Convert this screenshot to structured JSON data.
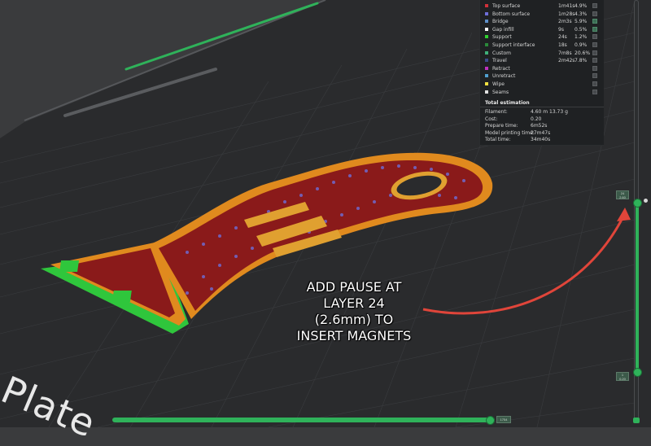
{
  "legend": {
    "features": [
      {
        "label": "Top surface",
        "time": "1m41s",
        "percent": "4.9%",
        "color": "#d0303a",
        "checked": false
      },
      {
        "label": "Bottom surface",
        "time": "1m28s",
        "percent": "4.3%",
        "color": "#6e6ed8",
        "checked": false
      },
      {
        "label": "Bridge",
        "time": "2m3s",
        "percent": "5.9%",
        "color": "#5d8fc9",
        "checked": true
      },
      {
        "label": "Gap infill",
        "time": "9s",
        "percent": "0.5%",
        "color": "#ffffff",
        "checked": true
      },
      {
        "label": "Support",
        "time": "24s",
        "percent": "1.2%",
        "color": "#2fd12f",
        "checked": false
      },
      {
        "label": "Support interface",
        "time": "18s",
        "percent": "0.9%",
        "color": "#2a8a3a",
        "checked": false
      },
      {
        "label": "Custom",
        "time": "7m8s",
        "percent": "20.6%",
        "color": "#3fb07a",
        "checked": false
      },
      {
        "label": "Travel",
        "time": "2m42s",
        "percent": "7.8%",
        "color": "#3a4a8a",
        "checked": false
      },
      {
        "label": "Retract",
        "time": "",
        "percent": "",
        "color": "#c030c0",
        "checked": false
      },
      {
        "label": "Unretract",
        "time": "",
        "percent": "",
        "color": "#50a0d0",
        "checked": false
      },
      {
        "label": "Wipe",
        "time": "",
        "percent": "",
        "color": "#f0e040",
        "checked": false
      },
      {
        "label": "Seams",
        "time": "",
        "percent": "",
        "color": "#e0e0e0",
        "checked": false
      }
    ],
    "estimation_title": "Total estimation",
    "estimation": [
      {
        "label": "Filament:",
        "value": "4.60 m    13.73 g"
      },
      {
        "label": "Cost:",
        "value": "0.20"
      },
      {
        "label": "Prepare time:",
        "value": "6m52s"
      },
      {
        "label": "Model printing time:",
        "value": "27m47s"
      },
      {
        "label": "Total time:",
        "value": "34m40s"
      }
    ]
  },
  "annotation": {
    "lines": [
      "ADD PAUSE AT",
      "LAYER 24",
      "(2.6mm) TO",
      "INSERT MAGNETS"
    ]
  },
  "plate_label": "l Plate",
  "slider": {
    "top_tag": "24\n2.60",
    "bottom_tag": "1\n0.20",
    "horizontal_tag": "1754"
  },
  "colors": {
    "accent": "#2fb25a",
    "model_orange": "#e08a1e",
    "infill_red": "#8a1a1a",
    "arrow": "#e0453a"
  }
}
